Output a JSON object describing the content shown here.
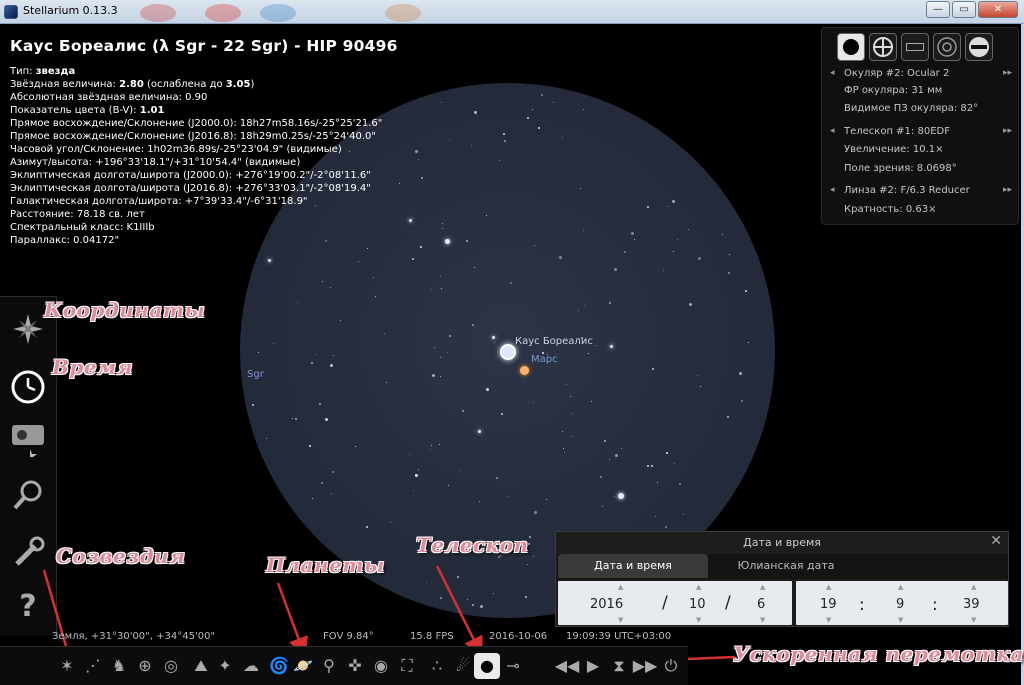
{
  "window": {
    "title": "Stellarium 0.13.3",
    "min_label": "—",
    "max_label": "▭",
    "close_label": "✕"
  },
  "object": {
    "title": "Каус Бореалис (λ Sgr - 22 Sgr) - HIP 90496",
    "type_label": "Тип: ",
    "type_value": "звезда",
    "app_mag_label": "Звёздная величина: ",
    "app_mag": "2.80",
    "app_mag_ext_pre": " (ослаблена до ",
    "app_mag_ext": "3.05",
    "app_mag_ext_post": ")",
    "abs_mag": "Абсолютная звёздная величина: 0.90",
    "color_index_label": "Показатель цвета (B-V): ",
    "color_index": "1.01",
    "ra_j2000": "Прямое восхождение/Склонение (J2000.0): 18h27m58.16s/-25°25'21.6\"",
    "ra_date": "Прямое восхождение/Склонение (J2016.8): 18h29m0.25s/-25°24'40.0\"",
    "hour_angle": "Часовой угол/Склонение: 1h02m36.89s/-25°23'04.9\" (видимые)",
    "az_alt": "Азимут/высота: +196°33'18.1\"/+31°10'54.4\" (видимые)",
    "ecl_j2000": "Эклиптическая долгота/широта (J2000.0): +276°19'00.2\"/-2°08'11.6\"",
    "ecl_date": "Эклиптическая долгота/широта (J2016.8): +276°33'03.1\"/-2°08'19.4\"",
    "gal": "Галактическая долгота/широта: +7°39'33.4\"/-6°31'18.9\"",
    "distance": "Расстояние: 78.18 св. лет",
    "spectral": "Спектральный класс: K1IIIb",
    "parallax": "Параллакс: 0.04172\""
  },
  "sky_labels": {
    "star": "Каус Бореалис",
    "planet": "Марс",
    "constellation": "Sgr"
  },
  "oculars": {
    "ocular_title": "Окуляр #2: Ocular 2",
    "ocular_fl": "ФР окуляра: 31 мм",
    "ocular_afov": "Видимое ПЗ окуляра: 82°",
    "telescope_title": "Телескоп #1: 80EDF",
    "magnification": "Увеличение: 10.1×",
    "fov": "Поле зрения: 8.0698°",
    "lens_title": "Линза #2: F/6.3 Reducer",
    "lens_mult": "Кратность: 0.63×",
    "arrow_prev": "◂",
    "arrow_next": "▸▸"
  },
  "annotations": {
    "coords": "Координаты",
    "time": "Время",
    "constellations": "Созвездия",
    "planets": "Планеты",
    "telescope": "Телескоп",
    "fast_forward": "Ускоренная перемотка"
  },
  "datetime": {
    "title": "Дата и время",
    "tab_date": "Дата и время",
    "tab_julian": "Юлианская дата",
    "year": "2016",
    "month": "10",
    "day": "6",
    "hour": "19",
    "minute": "9",
    "second": "39",
    "date_sep": "/",
    "time_sep": ":",
    "close_label": "✕"
  },
  "status": {
    "location": "Земля, +31°30'00\", +34°45'00\"",
    "fov": "FOV 9.84°",
    "fps": "15.8 FPS",
    "date": "2016-10-06",
    "time": "19:09:39 UTC+03:00"
  }
}
